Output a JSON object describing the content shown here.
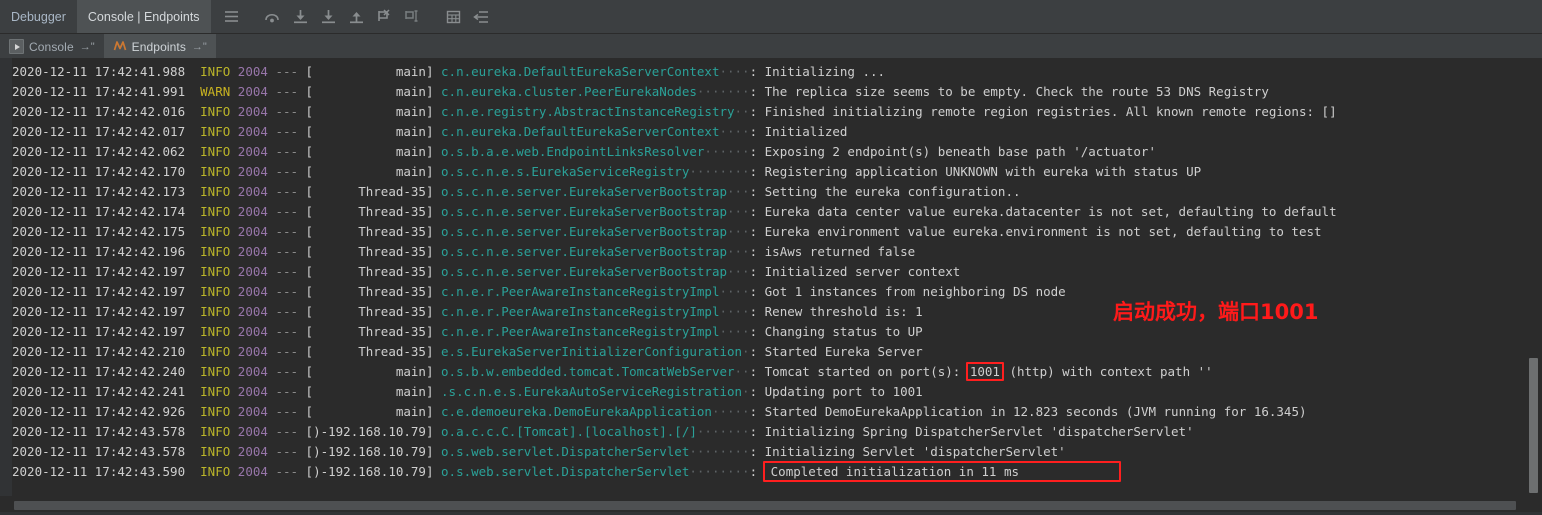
{
  "window": {
    "top_tabs": [
      {
        "label": "Debugger",
        "active": false
      },
      {
        "label": "Console | Endpoints",
        "active": true
      }
    ],
    "toolbar_icons": [
      "menu-icon",
      "step-over-icon",
      "step-into-icon",
      "force-step-into-icon",
      "step-out-icon",
      "run-to-cursor-icon",
      "evaluate-expression-icon",
      "table-view-icon",
      "soft-wrap-icon"
    ],
    "sub_tabs": [
      {
        "label": "Console",
        "icon": "run-console-icon",
        "pin": "→\"",
        "selected": false
      },
      {
        "label": "Endpoints",
        "icon": "endpoints-icon",
        "pin": "→\"",
        "selected": true
      }
    ]
  },
  "annotations": {
    "note_cn": "启动成功，端口1001",
    "note_color": "#ff1a1a",
    "highlight_port": "1001",
    "highlight_message": "Completed initialization in 11 ms"
  },
  "colors": {
    "background": "#2b2b2b",
    "chrome": "#3c3f41",
    "tab_active": "#4e5254",
    "info_level": "#bbb529",
    "warn_level": "#c9b321",
    "pid": "#9876aa",
    "logger": "#2aa198",
    "text": "#cfcfcf",
    "accent_red": "#ff1f1f"
  },
  "console": {
    "lines": [
      {
        "date": "2020-12-11 17:42:41.988",
        "level": "INFO",
        "pid": "2004",
        "dash": "---",
        "thread": "[           main]",
        "logger": "c.n.eureka.DefaultEurekaServerContext",
        "dots": "   ",
        "msg": "Initializing ..."
      },
      {
        "date": "2020-12-11 17:42:41.991",
        "level": "WARN",
        "pid": "2004",
        "dash": "---",
        "thread": "[           main]",
        "logger": "c.n.eureka.cluster.PeerEurekaNodes",
        "dots": "      ",
        "msg": "The replica size seems to be empty. Check the route 53 DNS Registry"
      },
      {
        "date": "2020-12-11 17:42:42.016",
        "level": "INFO",
        "pid": "2004",
        "dash": "---",
        "thread": "[           main]",
        "logger": "c.n.e.registry.AbstractInstanceRegistry",
        "dots": " ",
        "msg": "Finished initializing remote region registries. All known remote regions: []"
      },
      {
        "date": "2020-12-11 17:42:42.017",
        "level": "INFO",
        "pid": "2004",
        "dash": "---",
        "thread": "[           main]",
        "logger": "c.n.eureka.DefaultEurekaServerContext",
        "dots": "   ",
        "msg": "Initialized"
      },
      {
        "date": "2020-12-11 17:42:42.062",
        "level": "INFO",
        "pid": "2004",
        "dash": "---",
        "thread": "[           main]",
        "logger": "o.s.b.a.e.web.EndpointLinksResolver",
        "dots": "     ",
        "msg": "Exposing 2 endpoint(s) beneath base path '/actuator'"
      },
      {
        "date": "2020-12-11 17:42:42.170",
        "level": "INFO",
        "pid": "2004",
        "dash": "---",
        "thread": "[           main]",
        "logger": "o.s.c.n.e.s.EurekaServiceRegistry",
        "dots": "       ",
        "msg": "Registering application UNKNOWN with eureka with status UP"
      },
      {
        "date": "2020-12-11 17:42:42.173",
        "level": "INFO",
        "pid": "2004",
        "dash": "---",
        "thread": "[      Thread-35]",
        "logger": "o.s.c.n.e.server.EurekaServerBootstrap",
        "dots": "  ",
        "msg": "Setting the eureka configuration.."
      },
      {
        "date": "2020-12-11 17:42:42.174",
        "level": "INFO",
        "pid": "2004",
        "dash": "---",
        "thread": "[      Thread-35]",
        "logger": "o.s.c.n.e.server.EurekaServerBootstrap",
        "dots": "  ",
        "msg": "Eureka data center value eureka.datacenter is not set, defaulting to default"
      },
      {
        "date": "2020-12-11 17:42:42.175",
        "level": "INFO",
        "pid": "2004",
        "dash": "---",
        "thread": "[      Thread-35]",
        "logger": "o.s.c.n.e.server.EurekaServerBootstrap",
        "dots": "  ",
        "msg": "Eureka environment value eureka.environment is not set, defaulting to test"
      },
      {
        "date": "2020-12-11 17:42:42.196",
        "level": "INFO",
        "pid": "2004",
        "dash": "---",
        "thread": "[      Thread-35]",
        "logger": "o.s.c.n.e.server.EurekaServerBootstrap",
        "dots": "  ",
        "msg": "isAws returned false"
      },
      {
        "date": "2020-12-11 17:42:42.197",
        "level": "INFO",
        "pid": "2004",
        "dash": "---",
        "thread": "[      Thread-35]",
        "logger": "o.s.c.n.e.server.EurekaServerBootstrap",
        "dots": "  ",
        "msg": "Initialized server context"
      },
      {
        "date": "2020-12-11 17:42:42.197",
        "level": "INFO",
        "pid": "2004",
        "dash": "---",
        "thread": "[      Thread-35]",
        "logger": "c.n.e.r.PeerAwareInstanceRegistryImpl",
        "dots": "   ",
        "msg": "Got 1 instances from neighboring DS node"
      },
      {
        "date": "2020-12-11 17:42:42.197",
        "level": "INFO",
        "pid": "2004",
        "dash": "---",
        "thread": "[      Thread-35]",
        "logger": "c.n.e.r.PeerAwareInstanceRegistryImpl",
        "dots": "   ",
        "msg": "Renew threshold is: 1"
      },
      {
        "date": "2020-12-11 17:42:42.197",
        "level": "INFO",
        "pid": "2004",
        "dash": "---",
        "thread": "[      Thread-35]",
        "logger": "c.n.e.r.PeerAwareInstanceRegistryImpl",
        "dots": "   ",
        "msg": "Changing status to UP"
      },
      {
        "date": "2020-12-11 17:42:42.210",
        "level": "INFO",
        "pid": "2004",
        "dash": "---",
        "thread": "[      Thread-35]",
        "logger": "e.s.EurekaServerInitializerConfiguration",
        "dots": "",
        "msg": "Started Eureka Server"
      },
      {
        "date": "2020-12-11 17:42:42.240",
        "level": "INFO",
        "pid": "2004",
        "dash": "---",
        "thread": "[           main]",
        "logger": "o.s.b.w.embedded.tomcat.TomcatWebServer",
        "dots": " ",
        "msg_pre": "Tomcat started on port(s): ",
        "msg_hl": "1001",
        "msg_post": " (http) with context path ''",
        "highlight": true
      },
      {
        "date": "2020-12-11 17:42:42.241",
        "level": "INFO",
        "pid": "2004",
        "dash": "---",
        "thread": "[           main]",
        "logger": ".s.c.n.e.s.EurekaAutoServiceRegistration",
        "dots": "",
        "msg": "Updating port to 1001"
      },
      {
        "date": "2020-12-11 17:42:42.926",
        "level": "INFO",
        "pid": "2004",
        "dash": "---",
        "thread": "[           main]",
        "logger": "c.e.demoeureka.DemoEurekaApplication",
        "dots": "    ",
        "msg": "Started DemoEurekaApplication in 12.823 seconds (JVM running for 16.345)"
      },
      {
        "date": "2020-12-11 17:42:43.578",
        "level": "INFO",
        "pid": "2004",
        "dash": "---",
        "thread": "[)-192.168.10.79]",
        "logger": "o.a.c.c.C.[Tomcat].[localhost].[/]",
        "dots": "       ",
        "msg": "Initializing Spring DispatcherServlet 'dispatcherServlet'"
      },
      {
        "date": "2020-12-11 17:42:43.578",
        "level": "INFO",
        "pid": "2004",
        "dash": "---",
        "thread": "[)-192.168.10.79]",
        "logger": "o.s.web.servlet.DispatcherServlet",
        "dots": "        ",
        "msg": "Initializing Servlet 'dispatcherServlet'"
      },
      {
        "date": "2020-12-11 17:42:43.590",
        "level": "INFO",
        "pid": "2004",
        "dash": "---",
        "thread": "[)-192.168.10.79]",
        "logger": "o.s.web.servlet.DispatcherServlet",
        "dots": "        ",
        "msg": "Completed initialization in 11 ms",
        "boxed": true
      }
    ]
  }
}
